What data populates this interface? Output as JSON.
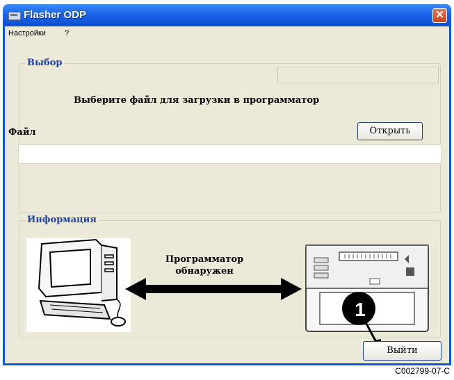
{
  "window": {
    "title": "Flasher ODP",
    "close_glyph": "✕"
  },
  "menu": {
    "items": [
      "Настройки",
      "?"
    ]
  },
  "selection_group": {
    "title": "Выбор",
    "instruction": "Выберите файл для загрузки в программатор",
    "file_label": "Файл",
    "file_path_value": "",
    "status_value": "",
    "open_button_label": "Открыть"
  },
  "info_group": {
    "title": "Информация",
    "status_line1": "Программатор",
    "status_line2": "обнаружен",
    "computer_image": "computer-illustration",
    "programmer_image": "programmer-device-illustration",
    "arrow": "double-headed-arrow"
  },
  "footer": {
    "exit_button_label": "Выйти"
  },
  "callout": {
    "number": "1"
  },
  "figure_code": "C002799-07-C",
  "colors": {
    "title_bar": "#0a57d8",
    "client_bg": "#ece9d8",
    "group_title": "#1b3fa8",
    "close_button": "#d5522c"
  }
}
